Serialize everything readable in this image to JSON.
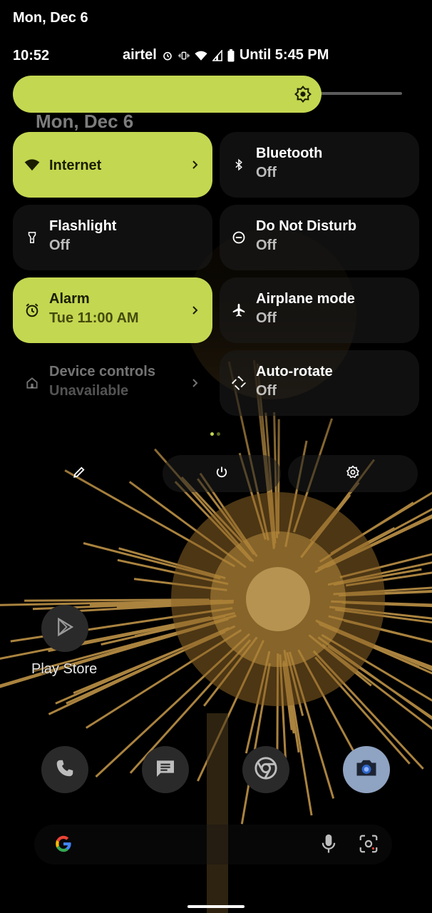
{
  "shade": {
    "date": "Mon, Dec 6",
    "status_bar": {
      "time": "10:52",
      "carrier": "airtel",
      "battery_text": "Until 5:45 PM",
      "icons": [
        "alarm-icon",
        "vibrate-icon",
        "wifi-icon",
        "cell-signal-icon",
        "battery-icon"
      ]
    },
    "brightness": {
      "level": 0.76,
      "icon": "brightness-icon"
    },
    "lockscreen_date": "Mon, Dec 6",
    "tiles": [
      {
        "label": "Internet",
        "sub": "",
        "icon": "wifi-icon",
        "state": "on",
        "chevron": true
      },
      {
        "label": "Bluetooth",
        "sub": "Off",
        "icon": "bluetooth-icon",
        "state": "off",
        "chevron": false
      },
      {
        "label": "Flashlight",
        "sub": "Off",
        "icon": "flashlight-icon",
        "state": "off",
        "chevron": false
      },
      {
        "label": "Do Not Disturb",
        "sub": "Off",
        "icon": "do-not-disturb-icon",
        "state": "off",
        "chevron": false
      },
      {
        "label": "Alarm",
        "sub": "Tue 11:00 AM",
        "icon": "alarm-icon",
        "state": "on",
        "chevron": true
      },
      {
        "label": "Airplane mode",
        "sub": "Off",
        "icon": "airplane-icon",
        "state": "off",
        "chevron": false
      },
      {
        "label": "Device controls",
        "sub": "Unavailable",
        "icon": "home-icon",
        "state": "disabled",
        "chevron": true
      },
      {
        "label": "Auto-rotate",
        "sub": "Off",
        "icon": "auto-rotate-icon",
        "state": "off",
        "chevron": false
      }
    ],
    "page_dots": {
      "count": 2,
      "active": 0
    },
    "actions": [
      "edit-icon",
      "power-icon",
      "settings-icon"
    ]
  },
  "home": {
    "play_store": {
      "label": "Play Store",
      "icon": "play-store-icon"
    },
    "dock": [
      "phone-icon",
      "messages-icon",
      "chrome-icon",
      "camera-icon"
    ],
    "search": {
      "left_icon": "google-icon",
      "right_icons": [
        "mic-icon",
        "lens-icon"
      ]
    }
  },
  "colors": {
    "accent": "#c4d751",
    "on_accent": "#1b1d00",
    "tile_off": "#1e1e1e",
    "background": "#000000"
  }
}
